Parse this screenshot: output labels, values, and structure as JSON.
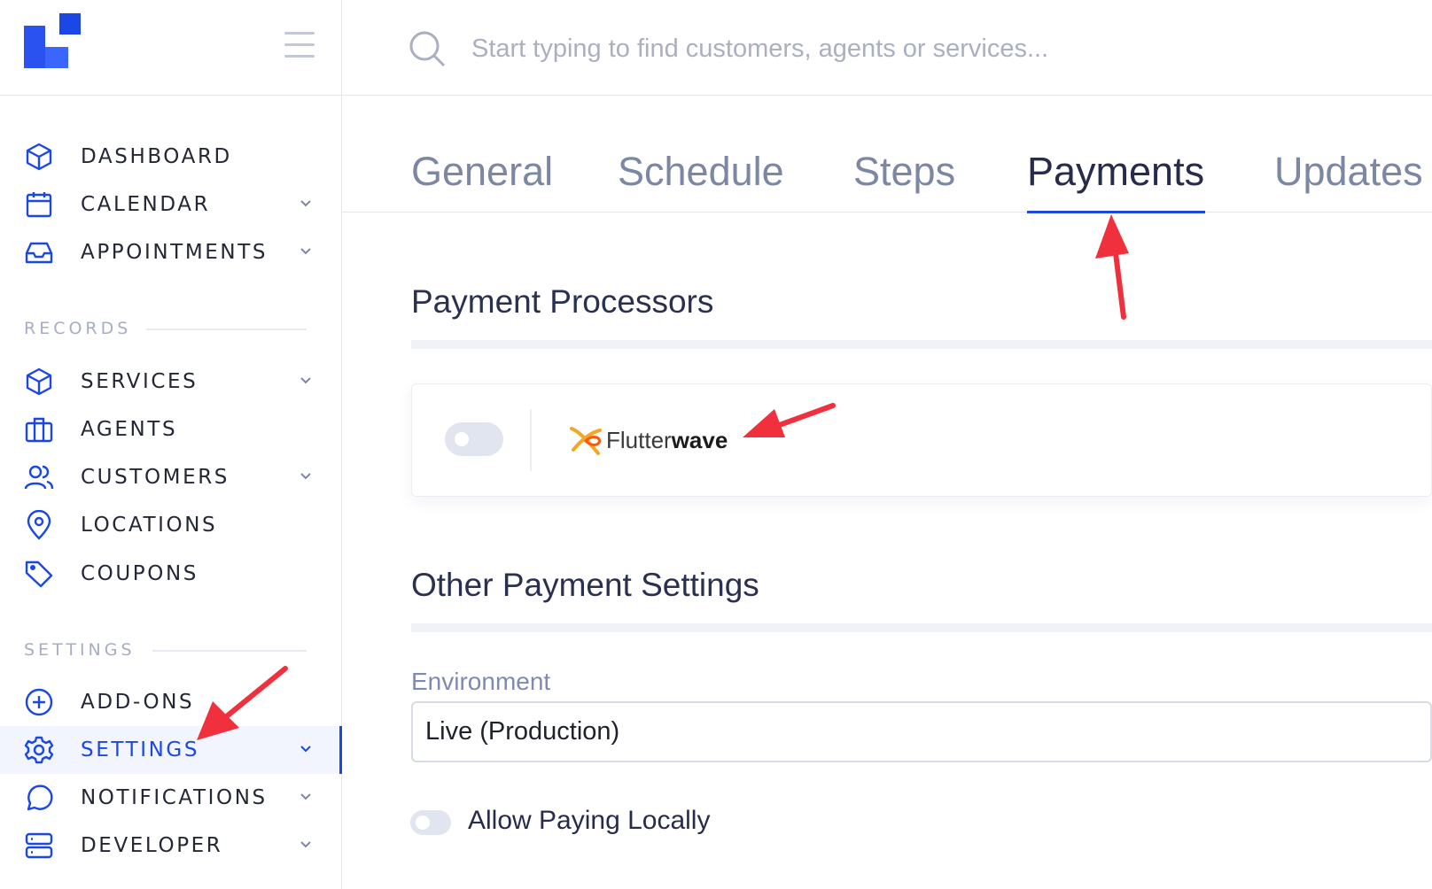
{
  "colors": {
    "accent": "#1b47e6",
    "muted": "#7c87a3",
    "annotation": "#f0303c"
  },
  "sidebar": {
    "main_items": [
      {
        "label": "DASHBOARD",
        "icon": "cube-icon"
      },
      {
        "label": "CALENDAR",
        "icon": "calendar-icon"
      },
      {
        "label": "APPOINTMENTS",
        "icon": "inbox-icon"
      }
    ],
    "records_heading": "RECORDS",
    "records_items": [
      {
        "label": "SERVICES",
        "icon": "cube-icon"
      },
      {
        "label": "AGENTS",
        "icon": "briefcase-icon"
      },
      {
        "label": "CUSTOMERS",
        "icon": "users-icon"
      },
      {
        "label": "LOCATIONS",
        "icon": "map-pin-icon"
      },
      {
        "label": "COUPONS",
        "icon": "tag-icon"
      }
    ],
    "settings_heading": "SETTINGS",
    "settings_items": [
      {
        "label": "ADD-ONS",
        "icon": "plus-circle-icon"
      },
      {
        "label": "SETTINGS",
        "icon": "gear-icon"
      },
      {
        "label": "NOTIFICATIONS",
        "icon": "chat-bubble-icon"
      },
      {
        "label": "DEVELOPER",
        "icon": "server-icon"
      }
    ]
  },
  "search": {
    "placeholder": "Start typing to find customers, agents or services..."
  },
  "tabs": [
    {
      "label": "General"
    },
    {
      "label": "Schedule"
    },
    {
      "label": "Steps"
    },
    {
      "label": "Payments"
    },
    {
      "label": "Updates"
    }
  ],
  "payment_processors": {
    "heading": "Payment Processors",
    "processor": {
      "name_regular": "Flutter",
      "name_bold": "wave",
      "enabled": false
    }
  },
  "other_settings": {
    "heading": "Other Payment Settings",
    "environment_label": "Environment",
    "environment_value": "Live (Production)",
    "allow_paying_locally_label": "Allow Paying Locally",
    "allow_paying_locally_enabled": false
  }
}
